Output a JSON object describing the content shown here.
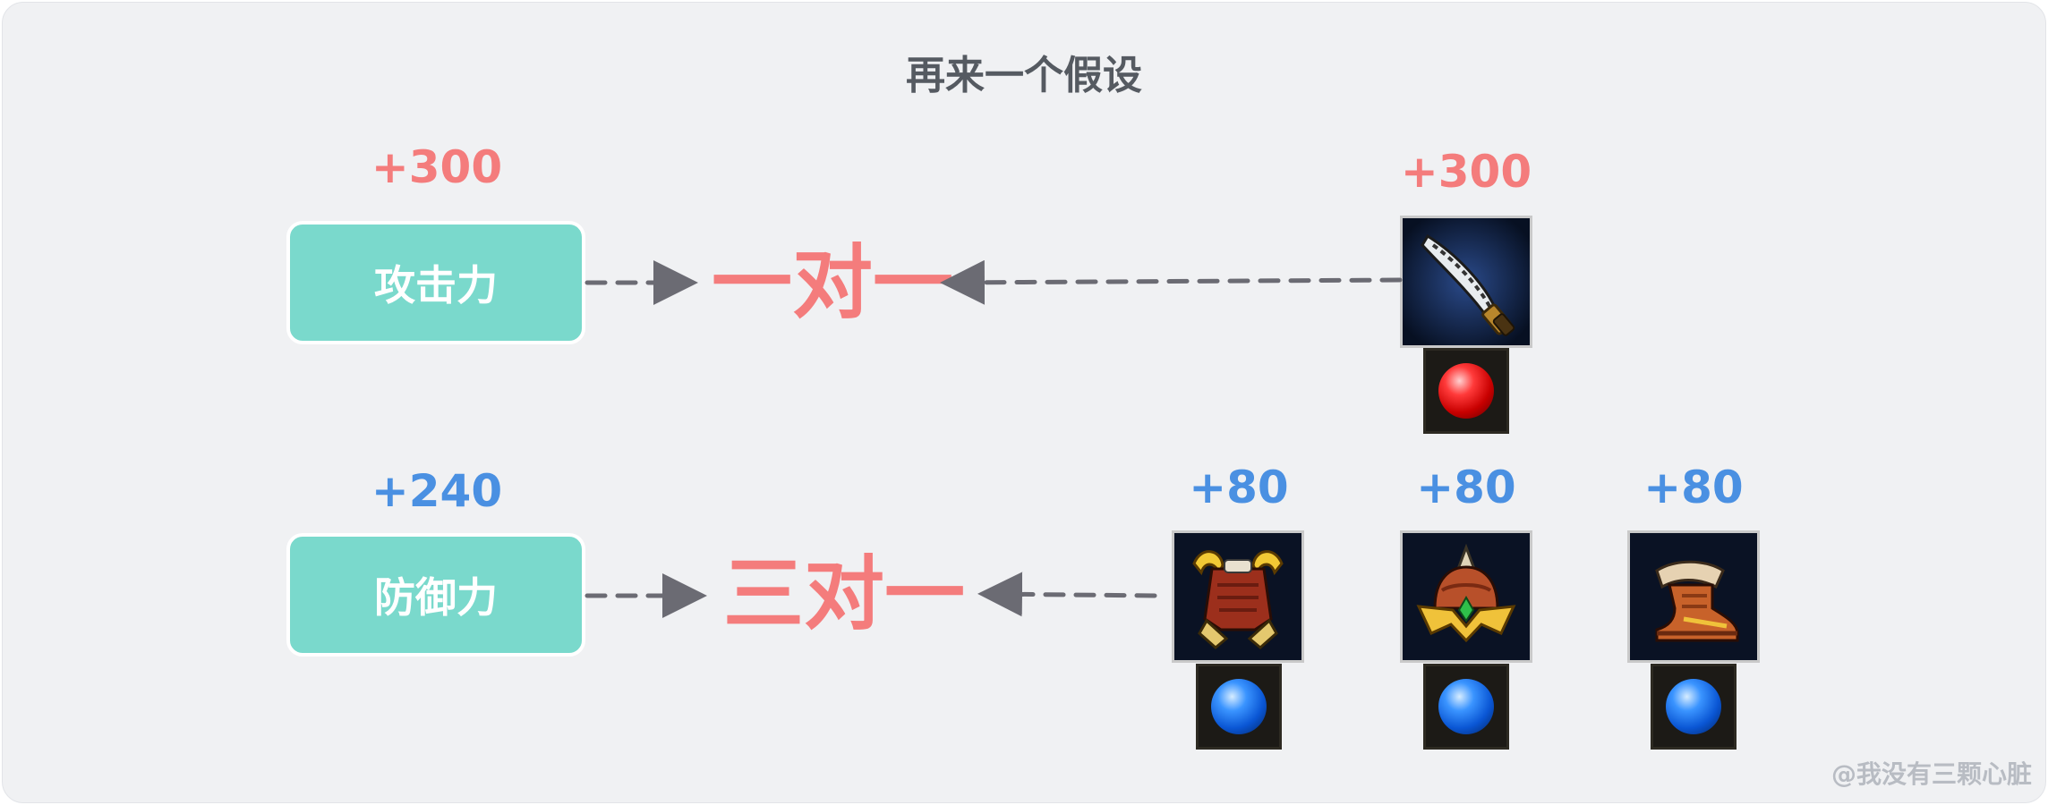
{
  "title": "再来一个假设",
  "rows": [
    {
      "stat_label": "攻击力",
      "stat_value": "+300",
      "ratio_label": "一对一",
      "items": [
        {
          "name": "sword-item",
          "value": "+300",
          "gem": "red"
        }
      ]
    },
    {
      "stat_label": "防御力",
      "stat_value": "+240",
      "ratio_label": "三对一",
      "items": [
        {
          "name": "armor-item",
          "value": "+80",
          "gem": "blue"
        },
        {
          "name": "helmet-item",
          "value": "+80",
          "gem": "blue"
        },
        {
          "name": "boots-item",
          "value": "+80",
          "gem": "blue"
        }
      ]
    }
  ],
  "watermark": "@我没有三颗心脏",
  "colors": {
    "stat_box": "#7ad9cc",
    "attack_value": "#f47c7c",
    "defense_value": "#4a90e2",
    "ratio_text": "#f47c7c",
    "arrow": "#6b6b73"
  }
}
